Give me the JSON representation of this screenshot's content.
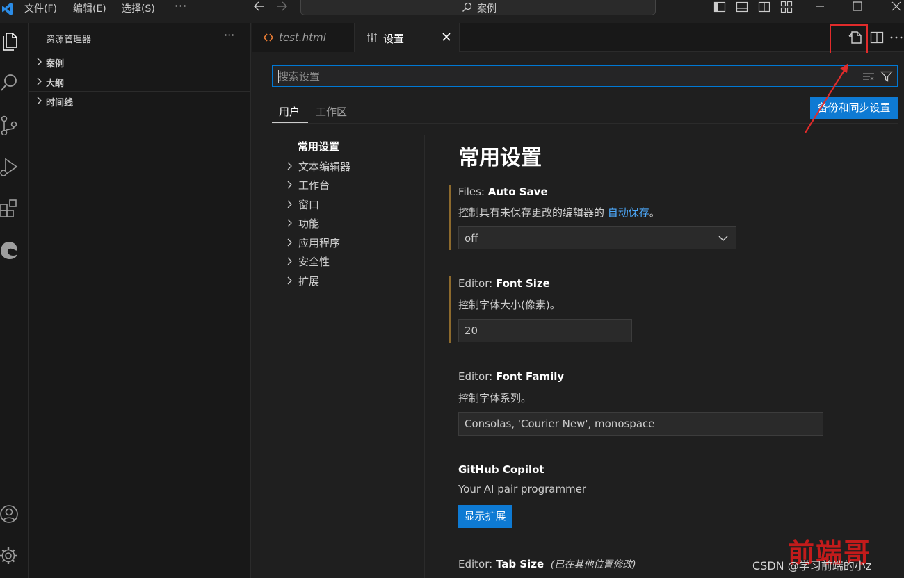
{
  "titlebar": {
    "menu": [
      "文件(F)",
      "编辑(E)",
      "选择(S)"
    ],
    "more": "···",
    "command_center": "案例"
  },
  "sidebar": {
    "title": "资源管理器",
    "more": "···",
    "sections": [
      "案例",
      "大纲",
      "时间线"
    ]
  },
  "tabs": [
    {
      "label": "test.html",
      "icon": "html-code-icon"
    },
    {
      "label": "设置",
      "icon": "settings-sliders-icon"
    }
  ],
  "settings": {
    "search_placeholder": "搜索设置",
    "scope_tabs": [
      "用户",
      "工作区"
    ],
    "sync_button": "备份和同步设置",
    "toc_title": "常用设置",
    "toc_items": [
      "文本编辑器",
      "工作台",
      "窗口",
      "功能",
      "应用程序",
      "安全性",
      "扩展"
    ],
    "group_title": "常用设置",
    "auto_save": {
      "category": "Files: ",
      "name": "Auto Save",
      "desc_prefix": "控制具有未保存更改的编辑器的 ",
      "desc_link": "自动保存",
      "desc_suffix": "。",
      "value": "off"
    },
    "font_size": {
      "category": "Editor: ",
      "name": "Font Size",
      "desc": "控制字体大小(像素)。",
      "value": "20"
    },
    "font_family": {
      "category": "Editor: ",
      "name": "Font Family",
      "desc": "控制字体系列。",
      "value": "Consolas, 'Courier New', monospace"
    },
    "copilot": {
      "name": "GitHub Copilot",
      "desc": "Your AI pair programmer",
      "button": "显示扩展"
    },
    "tab_size": {
      "category": "Editor: ",
      "name": "Tab Size",
      "note": "(已在其他位置修改)"
    }
  },
  "watermark": "CSDN @学习前端的小z",
  "brand": "前端哥",
  "colors": {
    "accent": "#0078d4",
    "button": "#0e7ad3",
    "link": "#4daafc",
    "annotation": "#e02b2b"
  }
}
